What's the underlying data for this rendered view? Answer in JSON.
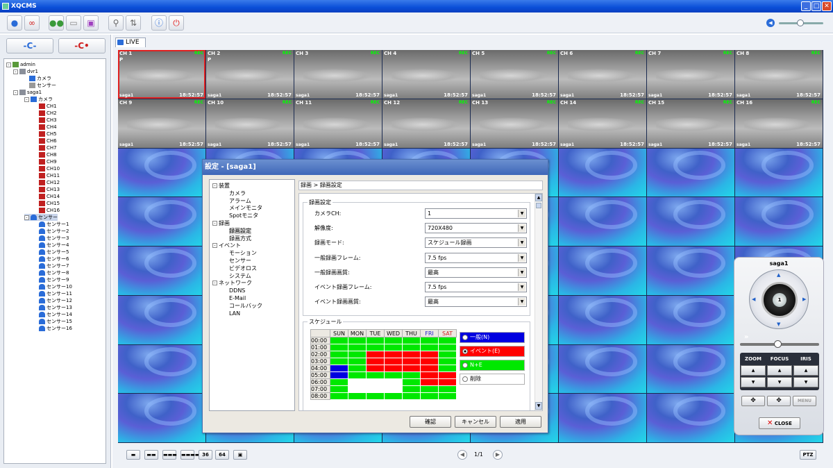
{
  "window": {
    "title": "XQCMS",
    "minimize": "_",
    "maximize": "□",
    "close": "✕"
  },
  "toolbar": {
    "icons": [
      "user-icon",
      "user-settings-icon",
      "group-icon",
      "device-icon",
      "monitor-icon",
      "search-icon",
      "playback-icon",
      "info-icon",
      "power-icon"
    ]
  },
  "left": {
    "connect_label": "-C-",
    "disconnect_label": "-C•"
  },
  "tree": {
    "root": "admin",
    "dvr1": {
      "name": "dvr1",
      "camera": "カメラ",
      "sensor": "センサー"
    },
    "saga1": {
      "name": "saga1",
      "camera": "カメラ",
      "sensor": "センサー",
      "channels": [
        "CH1",
        "CH2",
        "CH3",
        "CH4",
        "CH5",
        "CH6",
        "CH7",
        "CH8",
        "CH9",
        "CH10",
        "CH11",
        "CH12",
        "CH13",
        "CH14",
        "CH15",
        "CH16"
      ],
      "sensors": [
        "センサー1",
        "センサー2",
        "センサー3",
        "センサー4",
        "センサー5",
        "センサー6",
        "センサー7",
        "センサー8",
        "センサー9",
        "センサー10",
        "センサー11",
        "センサー12",
        "センサー13",
        "センサー14",
        "センサー15",
        "センサー16"
      ]
    }
  },
  "live": {
    "tab": "LIVE",
    "cams": [
      {
        "label": "CH 1",
        "sub": "P"
      },
      {
        "label": "CH 2",
        "sub": "P"
      },
      {
        "label": "CH 3",
        "sub": ""
      },
      {
        "label": "CH 4",
        "sub": ""
      },
      {
        "label": "CH 5",
        "sub": ""
      },
      {
        "label": "CH 6",
        "sub": ""
      },
      {
        "label": "CH 7",
        "sub": ""
      },
      {
        "label": "CH 8",
        "sub": ""
      },
      {
        "label": "CH 9",
        "sub": ""
      },
      {
        "label": "CH 10",
        "sub": ""
      },
      {
        "label": "CH 11",
        "sub": ""
      },
      {
        "label": "CH 12",
        "sub": ""
      },
      {
        "label": "CH 13",
        "sub": ""
      },
      {
        "label": "CH 14",
        "sub": ""
      },
      {
        "label": "CH 15",
        "sub": ""
      },
      {
        "label": "CH 16",
        "sub": ""
      }
    ],
    "site": "saga1",
    "time": "18:52:57",
    "tag": "REC"
  },
  "bottom": {
    "layouts": [
      "▬",
      "▬▬",
      "▬▬▬",
      "▬▬▬▬",
      "36",
      "64",
      "▣"
    ],
    "page": "1/1",
    "prev": "◀",
    "next": "▶",
    "ptz": "PTZ"
  },
  "dialog": {
    "title": "設定 - [saga1]",
    "tree": [
      {
        "label": "装置",
        "level": 0,
        "pm": "-"
      },
      {
        "label": "カメラ",
        "level": 1
      },
      {
        "label": "アラーム",
        "level": 1
      },
      {
        "label": "メインモニタ",
        "level": 1
      },
      {
        "label": "Spotモニタ",
        "level": 1
      },
      {
        "label": "録画",
        "level": 0,
        "pm": "-"
      },
      {
        "label": "録画設定",
        "level": 1,
        "selected": true
      },
      {
        "label": "録画方式",
        "level": 1
      },
      {
        "label": "イベント",
        "level": 0,
        "pm": "-"
      },
      {
        "label": "モーション",
        "level": 1
      },
      {
        "label": "センサー",
        "level": 1
      },
      {
        "label": "ビデオロス",
        "level": 1
      },
      {
        "label": "システム",
        "level": 1
      },
      {
        "label": "ネットワーク",
        "level": 0,
        "pm": "-"
      },
      {
        "label": "DDNS",
        "level": 1
      },
      {
        "label": "E-Mail",
        "level": 1
      },
      {
        "label": "コールバック",
        "level": 1
      },
      {
        "label": "LAN",
        "level": 1
      }
    ],
    "breadcrumb": "録画 > 録画設定",
    "group1": "録画設定",
    "fields": [
      {
        "label": "カメラCH:",
        "value": "1"
      },
      {
        "label": "解像度:",
        "value": "720X480"
      },
      {
        "label": "録画モード:",
        "value": "スケジュール録画"
      },
      {
        "label": "一般録画フレーム:",
        "value": "7.5 fps"
      },
      {
        "label": "一般録画画質:",
        "value": "最高"
      },
      {
        "label": "イベント録画フレーム:",
        "value": "7.5 fps"
      },
      {
        "label": "イベント録画画質:",
        "value": "最高"
      }
    ],
    "group2": "スケジュール",
    "days": [
      "SUN",
      "MON",
      "TUE",
      "WED",
      "THU",
      "FRI",
      "SAT"
    ],
    "hours": [
      "00:00",
      "01:00",
      "02:00",
      "03:00",
      "04:00",
      "05:00",
      "06:00",
      "07:00",
      "08:00"
    ],
    "grid": [
      [
        "g",
        "g",
        "g",
        "g",
        "g",
        "g",
        "g"
      ],
      [
        "g",
        "g",
        "g",
        "g",
        "g",
        "g",
        "g"
      ],
      [
        "g",
        "g",
        "r",
        "r",
        "r",
        "r",
        "g"
      ],
      [
        "g",
        "g",
        "r",
        "r",
        "r",
        "r",
        "g"
      ],
      [
        "b",
        "g",
        "r",
        "r",
        "r",
        "r",
        "g"
      ],
      [
        "b",
        "g",
        "g",
        "g",
        "g",
        "r",
        "r"
      ],
      [
        "g",
        "w",
        "w",
        "w",
        "g",
        "r",
        "r"
      ],
      [
        "g",
        "w",
        "w",
        "w",
        "g",
        "g",
        "g"
      ],
      [
        "g",
        "g",
        "g",
        "g",
        "g",
        "g",
        "g"
      ]
    ],
    "legend": [
      {
        "label": "一般(N)",
        "color": "#0000e0",
        "checked": false
      },
      {
        "label": "イベント(E)",
        "color": "#ff0000",
        "checked": true
      },
      {
        "label": "N+E",
        "color": "#00e800",
        "checked": false
      },
      {
        "label": "削除",
        "color": "#ffffff",
        "checked": false
      }
    ],
    "buttons": {
      "confirm": "確認",
      "cancel": "キャンセル",
      "apply": "適用"
    }
  },
  "ptz": {
    "title": "saga1",
    "dial": "1",
    "zoom": "ZOOM",
    "focus": "FOCUS",
    "iris": "IRIS",
    "menu": "MENU",
    "close": "CLOSE"
  }
}
